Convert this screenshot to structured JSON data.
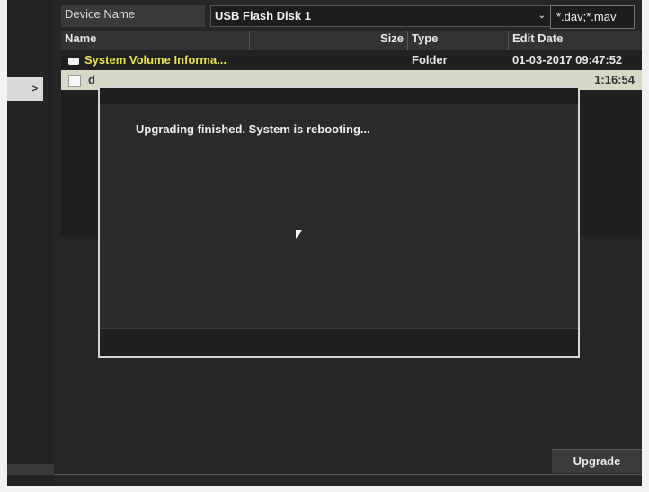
{
  "device": {
    "label": "Device Name",
    "selected": "USB Flash Disk 1",
    "filter": "*.dav;*.mav"
  },
  "table": {
    "columns": [
      "Name",
      "Size",
      "Type",
      "Edit Date"
    ],
    "rows": [
      {
        "name": "System Volume Informa...",
        "size": "",
        "type": "Folder",
        "date": "01-03-2017 09:47:52"
      },
      {
        "name": "d",
        "size": "",
        "type": "",
        "date": "1:16:54"
      }
    ]
  },
  "dialog": {
    "message": "Upgrading finished. System is rebooting..."
  },
  "actions": {
    "expand": ">",
    "upgrade": "Upgrade"
  },
  "colors": {
    "highlight_text": "#e8e34a",
    "dialog_border": "#d6d6d6"
  }
}
